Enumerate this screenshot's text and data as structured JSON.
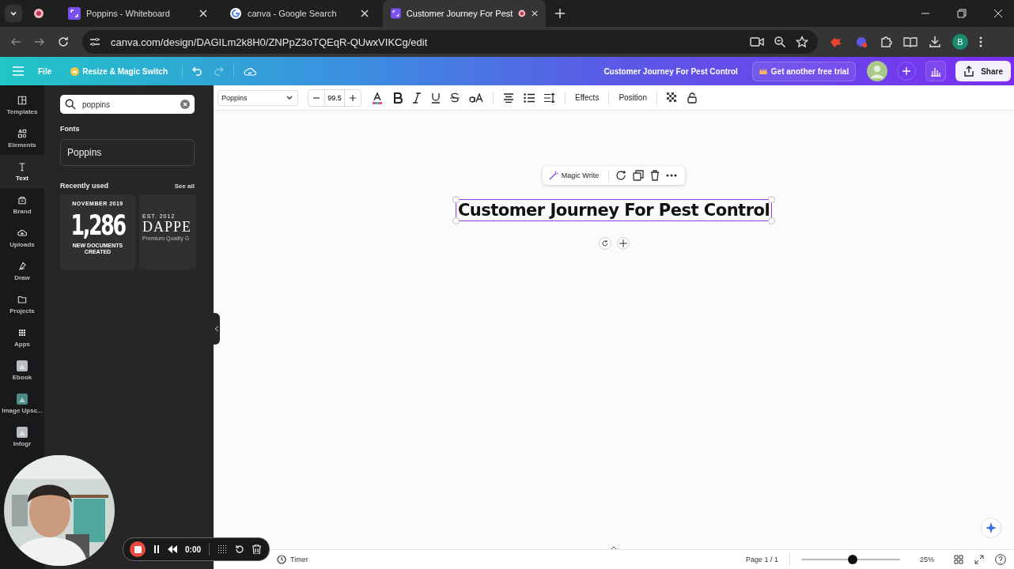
{
  "browser": {
    "tabs": [
      {
        "title": "Poppins - Whiteboard",
        "selected": false,
        "recording": false
      },
      {
        "title": "canva - Google Search",
        "selected": false,
        "recording": false
      },
      {
        "title": "Customer Journey For Pest",
        "selected": true,
        "recording": true
      }
    ],
    "url": "canva.com/design/DAGILm2k8H0/ZNPpZ3oTQEqR-QUwxVIKCg/edit",
    "profile": "B"
  },
  "header": {
    "file": "File",
    "magic": "Resize & Magic Switch",
    "doc_title": "Customer Journey For Pest Control",
    "trial": "Get another free trial",
    "share": "Share"
  },
  "rail": [
    {
      "label": "Templates",
      "selected": false
    },
    {
      "label": "Elements",
      "selected": false
    },
    {
      "label": "Text",
      "selected": true
    },
    {
      "label": "Brand",
      "selected": false
    },
    {
      "label": "Uploads",
      "selected": false
    },
    {
      "label": "Draw",
      "selected": false
    },
    {
      "label": "Projects",
      "selected": false
    },
    {
      "label": "Apps",
      "selected": false
    },
    {
      "label": "Ebook",
      "selected": false
    },
    {
      "label": "Image Upsc...",
      "selected": false
    },
    {
      "label": "Infogr",
      "selected": false
    }
  ],
  "panel": {
    "search": "poppins",
    "fonts_heading": "Fonts",
    "font": "Poppins",
    "recent_heading": "Recently used",
    "see_all": "See all",
    "templates": [
      {
        "kind": "stat",
        "top": "NOVEMBER 2019",
        "big": "1,286",
        "bottom": "NEW DOCUMENTS CREATED"
      },
      {
        "kind": "brand",
        "top": "EST. 2012",
        "big": "DAPPE",
        "bottom": "Premium Quality G"
      }
    ]
  },
  "toolbar": {
    "font": "Poppins",
    "size": "99.5",
    "effects": "Effects",
    "position": "Position"
  },
  "canvas": {
    "magic_write": "Magic Write",
    "text": "Customer Journey For Pest Control"
  },
  "footer": {
    "timer": "Timer",
    "page": "Page 1 / 1",
    "zoom": {
      "level": 0.52
    },
    "zoom_reading": "25%"
  },
  "recorder": {
    "time": "0:00"
  }
}
